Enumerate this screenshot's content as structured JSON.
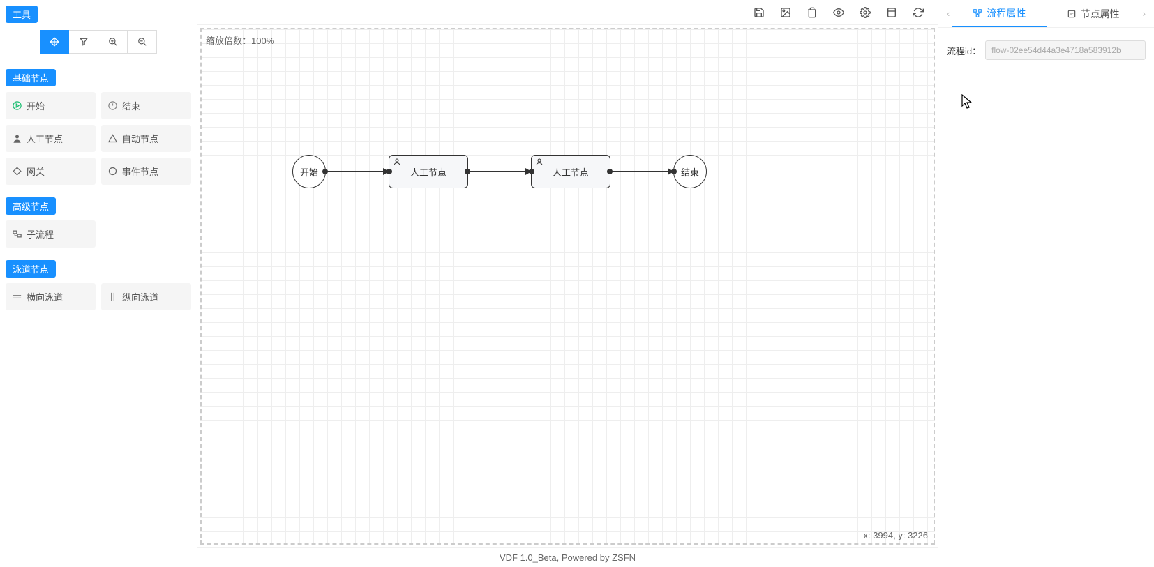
{
  "sidebar": {
    "tool_label": "工具",
    "sections": {
      "basic": {
        "label": "基础节点",
        "items": [
          "开始",
          "结束",
          "人工节点",
          "自动节点",
          "网关",
          "事件节点"
        ]
      },
      "advanced": {
        "label": "高级节点",
        "items": [
          "子流程"
        ]
      },
      "lane": {
        "label": "泳道节点",
        "items": [
          "横向泳道",
          "纵向泳道"
        ]
      }
    }
  },
  "canvas": {
    "zoom_label": "缩放倍数：",
    "zoom_value": "100%",
    "coord_prefix_x": "x: ",
    "coord_x": "3994",
    "coord_mid": ", y: ",
    "coord_y": "3226",
    "nodes": {
      "start": "开始",
      "task1": "人工节点",
      "task2": "人工节点",
      "end": "结束"
    }
  },
  "footer": {
    "text": "VDF 1.0_Beta, Powered by ZSFN"
  },
  "right": {
    "tab_flow": "流程属性",
    "tab_node": "节点属性",
    "flow_id_label": "流程id：",
    "flow_id_value": "flow-02ee54d44a3e4718a583912b"
  }
}
